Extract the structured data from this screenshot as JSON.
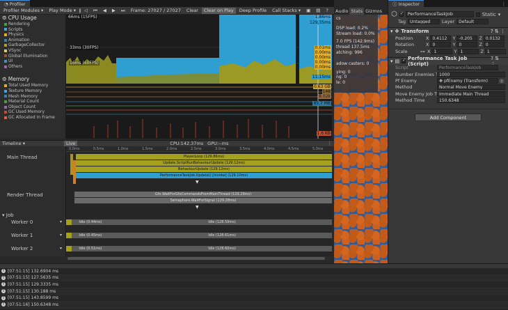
{
  "profiler": {
    "tab_title": "Profiler",
    "modules_label": "Profiler Modules",
    "play_mode": "Play Mode",
    "frame": "Frame: 27027 / 27027",
    "clear": "Clear",
    "clear_on_play": "Clear on Play",
    "deep_profile": "Deep Profile",
    "call_stacks": "Call Stacks"
  },
  "cpu": {
    "title": "CPU Usage",
    "items": [
      {
        "label": "Rendering",
        "color": "#4a9f3f"
      },
      {
        "label": "Scripts",
        "color": "#4aa3d8"
      },
      {
        "label": "Physics",
        "color": "#e3b02c"
      },
      {
        "label": "Animation",
        "color": "#3a7fb0"
      },
      {
        "label": "GarbageCollector",
        "color": "#b0a030"
      },
      {
        "label": "VSync",
        "color": "#e0c870"
      },
      {
        "label": "Global Illumination",
        "color": "#8a5a2a"
      },
      {
        "label": "UI",
        "color": "#4a8fc0"
      },
      {
        "label": "Others",
        "color": "#9a6aa8"
      }
    ],
    "ref_66": "66ms (15FPS)",
    "ref_33": "33ms (30FPS)",
    "ref_16": "16ms (60FPS)",
    "values": [
      "1.86ms",
      "129.35ms",
      "0.01ms",
      "0.00ms",
      "0.00ms",
      "0.00ms",
      "0.00ms",
      "11.15ms"
    ]
  },
  "memory": {
    "title": "Memory",
    "items": [
      {
        "label": "Total Used Memory",
        "color": "#e3b02c"
      },
      {
        "label": "Texture Memory",
        "color": "#4aa3d8"
      },
      {
        "label": "Mesh Memory",
        "color": "#3a7fb0"
      },
      {
        "label": "Material Count",
        "color": "#4a9f3f"
      },
      {
        "label": "Object Count",
        "color": "#9a6aa8"
      },
      {
        "label": "GC Used Memory",
        "color": "#c05030"
      },
      {
        "label": "GC Allocated In Frame",
        "color": "#e06040"
      }
    ],
    "values": [
      "0.63 GB",
      "148",
      "8.02k",
      "85.7 MB",
      "1.6 KB"
    ]
  },
  "timeline": {
    "view": "Timeline",
    "live": "Live",
    "cpu": "CPU:142.37ms",
    "gpu": "GPU:--ms",
    "ticks": [
      "0.0ms",
      "0.5ms",
      "1.0ms",
      "1.5ms",
      "2.0ms",
      "2.5ms",
      "3.0ms",
      "3.5ms",
      "4.0ms",
      "4.5ms",
      "5.0ms"
    ],
    "threads": {
      "main": "Main Thread",
      "render": "Render Thread",
      "job": "Job",
      "w0": "Worker 0",
      "w1": "Worker 1",
      "w2": "Worker 2"
    },
    "bars": {
      "player_loop": "PlayerLoop (129.86ms)",
      "update_script": "Update.ScriptRunBehaviourUpdate (129.12ms)",
      "behaviour_update": "BehaviourUpdate (129.12ms)",
      "perf_task": "PerformanceTaskJob.Update() [Invoke] (129.10ms)",
      "wait_gfx": "Gfx.WaitForGfxCommandsFromMainThread (129.29ms)",
      "semaphore": "Semaphore.WaitForSignal (129.28ms)",
      "idle_w0_a": "Idle (0.44ms)",
      "idle_w0_b": "Idle (128.59ms)",
      "idle_w1_a": "Idle (0.45ms)",
      "idle_w1_b": "Idle (128.61ms)",
      "idle_w2_a": "Idle (0.51ms)",
      "idle_w2_b": "Idle (128.60ms)"
    }
  },
  "game": {
    "tabs": [
      "Audio",
      "Stats",
      "Gizmos"
    ],
    "stats": [
      "DSP load: 0.2%",
      "Stream load: 0.0%",
      "7.0 FPS (142.9ms)",
      "thread 137.5ms",
      "atching: 996",
      "adow casters: 0",
      "ying: 0",
      "ng: 0",
      "le: 0"
    ],
    "stats_prefix": "cs"
  },
  "inspector": {
    "tab_title": "Inspector",
    "object_name": "PerformanceTaskJob",
    "static_label": "Static",
    "tag_label": "Tag",
    "tag_value": "Untagged",
    "layer_label": "Layer",
    "layer_value": "Default",
    "transform": {
      "title": "Transform",
      "position_label": "Position",
      "rotation_label": "Rotation",
      "scale_label": "Scale",
      "position": [
        "0.4112",
        "-0.205",
        "0.0132"
      ],
      "rotation": [
        "0",
        "0",
        "0"
      ],
      "scale": [
        "1",
        "1",
        "1"
      ],
      "axes": [
        "X",
        "Y",
        "Z"
      ]
    },
    "script_comp": {
      "title": "Performance Task Job (Script)",
      "script_label": "Script",
      "script_value": "PerformanceTaskJob",
      "num_label": "Number Enemies To C",
      "num_value": "1000",
      "pf_label": "Pf Enemy",
      "pf_value": "pfEnemy (Transform)",
      "method_label": "Method",
      "method_value": "Normal Move Enemy",
      "move_label": "Move Enemy Job Typ",
      "move_value": "Immediate Main Thread",
      "time_label": "Method Time",
      "time_value": "150.6348"
    },
    "add_component": "Add Component"
  },
  "console": {
    "lines": [
      "[07:51:15] 132.6904 ms",
      "[07:51:15] 127.5635 ms",
      "[07:51:15] 129.3335 ms",
      "[07:51:15] 130.188 ms",
      "[07:51:15] 143.8599 ms",
      "[07:51:16] 150.6348 ms"
    ]
  }
}
